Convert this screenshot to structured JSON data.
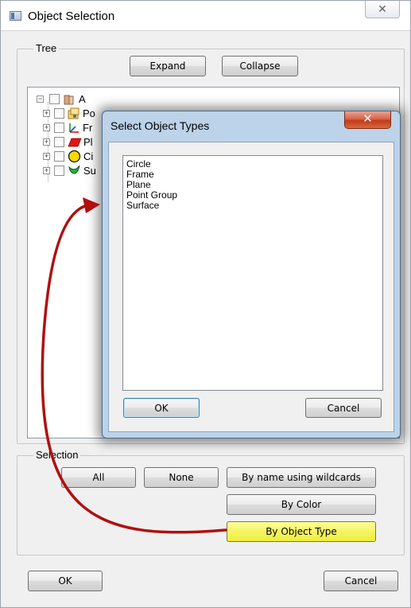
{
  "window": {
    "title": "Object Selection",
    "close_glyph": "✕"
  },
  "tree_group": {
    "label": "Tree",
    "expand_label": "Expand",
    "collapse_label": "Collapse",
    "root": "A",
    "children": [
      "Po",
      "Fr",
      "Pl",
      "Ci",
      "Su"
    ]
  },
  "dialog": {
    "title": "Select Object Types",
    "close_glyph": "✕",
    "items": [
      "Circle",
      "Frame",
      "Plane",
      "Point Group",
      "Surface"
    ],
    "ok_label": "OK",
    "cancel_label": "Cancel"
  },
  "selection_group": {
    "label": "Selection",
    "all_label": "All",
    "none_label": "None",
    "wildcards_label": "By name using wildcards",
    "color_label": "By Color",
    "object_type_label": "By Object Type"
  },
  "footer": {
    "ok_label": "OK",
    "cancel_label": "Cancel"
  },
  "colors": {
    "highlight_button": "#f4f466",
    "arrow": "#b01010",
    "dialog_frame": "#bcd3ea"
  }
}
